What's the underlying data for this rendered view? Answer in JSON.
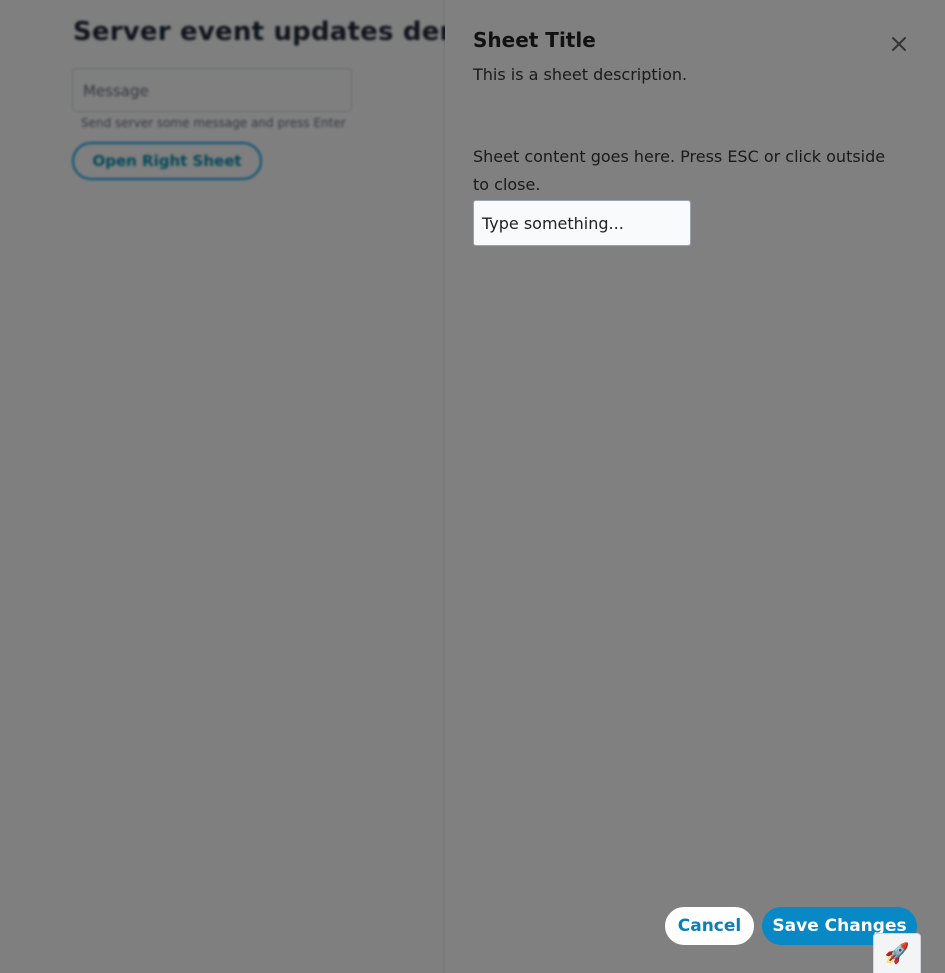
{
  "background_page": {
    "title": "Server event updates demo",
    "message_placeholder": "Message",
    "message_hint": "Send server some message and press Enter",
    "open_sheet_label": "Open Right Sheet"
  },
  "sheet": {
    "title": "Sheet Title",
    "description": "This is a sheet description.",
    "content_text": "Sheet content goes here. Press ESC or click outside to close.",
    "input_placeholder": "Type something...",
    "close_icon": "close-icon",
    "cancel_label": "Cancel",
    "save_label": "Save Changes"
  },
  "launcher": {
    "icon": "rocket-icon",
    "glyph": "🚀"
  },
  "colors": {
    "overlay": "rgba(0,0,0,0.5)",
    "sheet_bg": "#808080",
    "primary": "#0888c4",
    "primary_text": "#0e7fb4"
  }
}
